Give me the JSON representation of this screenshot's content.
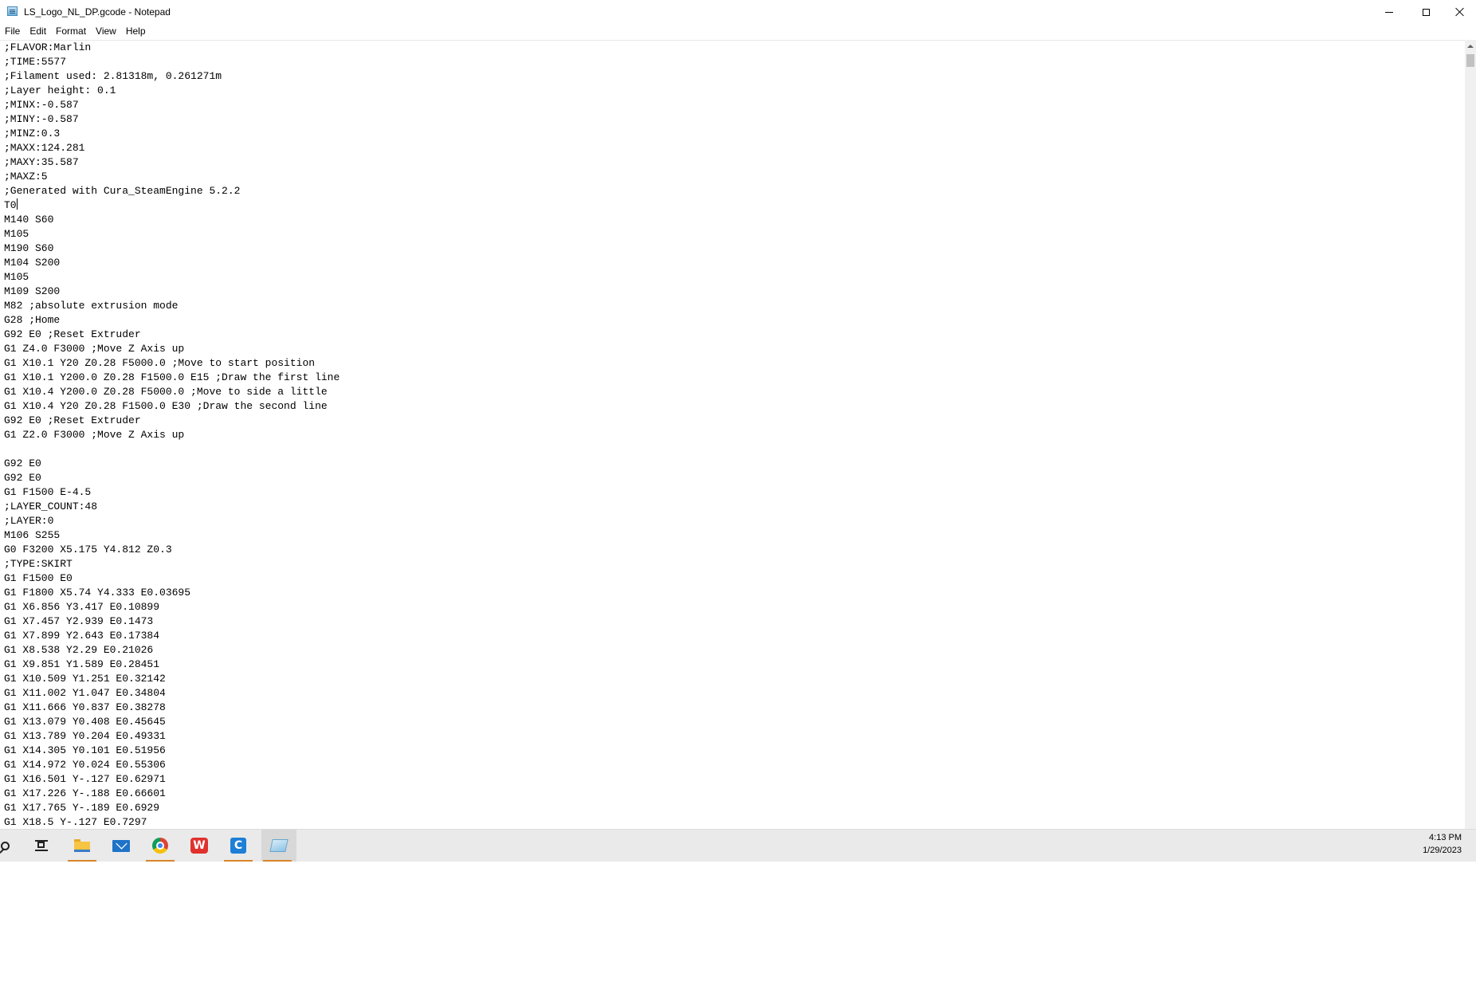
{
  "window": {
    "title": "LS_Logo_NL_DP.gcode - Notepad",
    "app_icon": "notepad-icon",
    "controls": {
      "minimize": "minimize-icon",
      "maximize": "maximize-icon",
      "close": "close-icon"
    }
  },
  "menu": {
    "items": [
      "File",
      "Edit",
      "Format",
      "View",
      "Help"
    ]
  },
  "editor": {
    "caret_line": 11,
    "lines": [
      ";FLAVOR:Marlin",
      ";TIME:5577",
      ";Filament used: 2.81318m, 0.261271m",
      ";Layer height: 0.1",
      ";MINX:-0.587",
      ";MINY:-0.587",
      ";MINZ:0.3",
      ";MAXX:124.281",
      ";MAXY:35.587",
      ";MAXZ:5",
      ";Generated with Cura_SteamEngine 5.2.2",
      "T0",
      "M140 S60",
      "M105",
      "M190 S60",
      "M104 S200",
      "M105",
      "M109 S200",
      "M82 ;absolute extrusion mode",
      "G28 ;Home",
      "G92 E0 ;Reset Extruder",
      "G1 Z4.0 F3000 ;Move Z Axis up",
      "G1 X10.1 Y20 Z0.28 F5000.0 ;Move to start position",
      "G1 X10.1 Y200.0 Z0.28 F1500.0 E15 ;Draw the first line",
      "G1 X10.4 Y200.0 Z0.28 F5000.0 ;Move to side a little",
      "G1 X10.4 Y20 Z0.28 F1500.0 E30 ;Draw the second line",
      "G92 E0 ;Reset Extruder",
      "G1 Z2.0 F3000 ;Move Z Axis up",
      "",
      "G92 E0",
      "G92 E0",
      "G1 F1500 E-4.5",
      ";LAYER_COUNT:48",
      ";LAYER:0",
      "M106 S255",
      "G0 F3200 X5.175 Y4.812 Z0.3",
      ";TYPE:SKIRT",
      "G1 F1500 E0",
      "G1 F1800 X5.74 Y4.333 E0.03695",
      "G1 X6.856 Y3.417 E0.10899",
      "G1 X7.457 Y2.939 E0.1473",
      "G1 X7.899 Y2.643 E0.17384",
      "G1 X8.538 Y2.29 E0.21026",
      "G1 X9.851 Y1.589 E0.28451",
      "G1 X10.509 Y1.251 E0.32142",
      "G1 X11.002 Y1.047 E0.34804",
      "G1 X11.666 Y0.837 E0.38278",
      "G1 X13.079 Y0.408 E0.45645",
      "G1 X13.789 Y0.204 E0.49331",
      "G1 X14.305 Y0.101 E0.51956",
      "G1 X14.972 Y0.024 E0.55306",
      "G1 X16.501 Y-.127 E0.62971",
      "G1 X17.226 Y-.188 E0.66601",
      "G1 X17.765 Y-.189 E0.6929",
      "G1 X18.5 Y-.127 E0.7297"
    ]
  },
  "taskbar": {
    "buttons": [
      {
        "name": "search-button",
        "icon": "search-icon"
      },
      {
        "name": "task-view-button",
        "icon": "task-view-icon"
      },
      {
        "name": "file-explorer-button",
        "icon": "folder-icon"
      },
      {
        "name": "mail-button",
        "icon": "mail-icon"
      },
      {
        "name": "chrome-button",
        "icon": "chrome-icon"
      },
      {
        "name": "wps-button",
        "icon": "wps-icon",
        "glyph": "W"
      },
      {
        "name": "cura-button",
        "icon": "cura-icon",
        "glyph": "C"
      },
      {
        "name": "notepad-button",
        "icon": "notepad-icon"
      }
    ],
    "clock": {
      "time": "4:13 PM",
      "date": "1/29/2023"
    },
    "accent_color": "#d9852a"
  }
}
